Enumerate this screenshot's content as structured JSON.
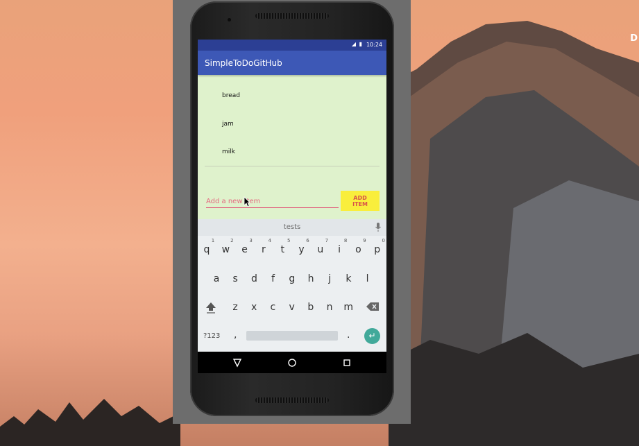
{
  "desktop": {
    "corner_text": "D"
  },
  "status_bar": {
    "time": "10:24",
    "icons": "◢ ▮"
  },
  "app": {
    "title": "SimpleToDoGitHub"
  },
  "todo_list": {
    "items": [
      "bread",
      "jam",
      "milk"
    ]
  },
  "new_item": {
    "placeholder": "Add a new item",
    "value": ""
  },
  "add_button": {
    "label": "ADD ITEM"
  },
  "keyboard": {
    "suggestion": "tests",
    "row1": [
      "q",
      "w",
      "e",
      "r",
      "t",
      "y",
      "u",
      "i",
      "o",
      "p"
    ],
    "row1_hints": [
      "1",
      "2",
      "3",
      "4",
      "5",
      "6",
      "7",
      "8",
      "9",
      "0"
    ],
    "row2": [
      "a",
      "s",
      "d",
      "f",
      "g",
      "h",
      "j",
      "k",
      "l"
    ],
    "row3": [
      "z",
      "x",
      "c",
      "v",
      "b",
      "n",
      "m"
    ],
    "symbols_label": "?123",
    "comma": ",",
    "period": ".",
    "enter_symbol": "↵"
  },
  "colors": {
    "app_bar": "#3d58b6",
    "status_bar": "#2c3f94",
    "screen_background": "#dff2cc",
    "add_button": "#f9ee3c",
    "add_button_text": "#d8534a",
    "input_underline": "#e0436e",
    "enter_key": "#41a99a"
  },
  "icons": {
    "mic": "mic-icon",
    "shift": "shift-icon",
    "backspace": "backspace-icon",
    "nav_back": "triangle-back-icon",
    "nav_home": "circle-home-icon",
    "nav_recents": "square-recents-icon"
  }
}
